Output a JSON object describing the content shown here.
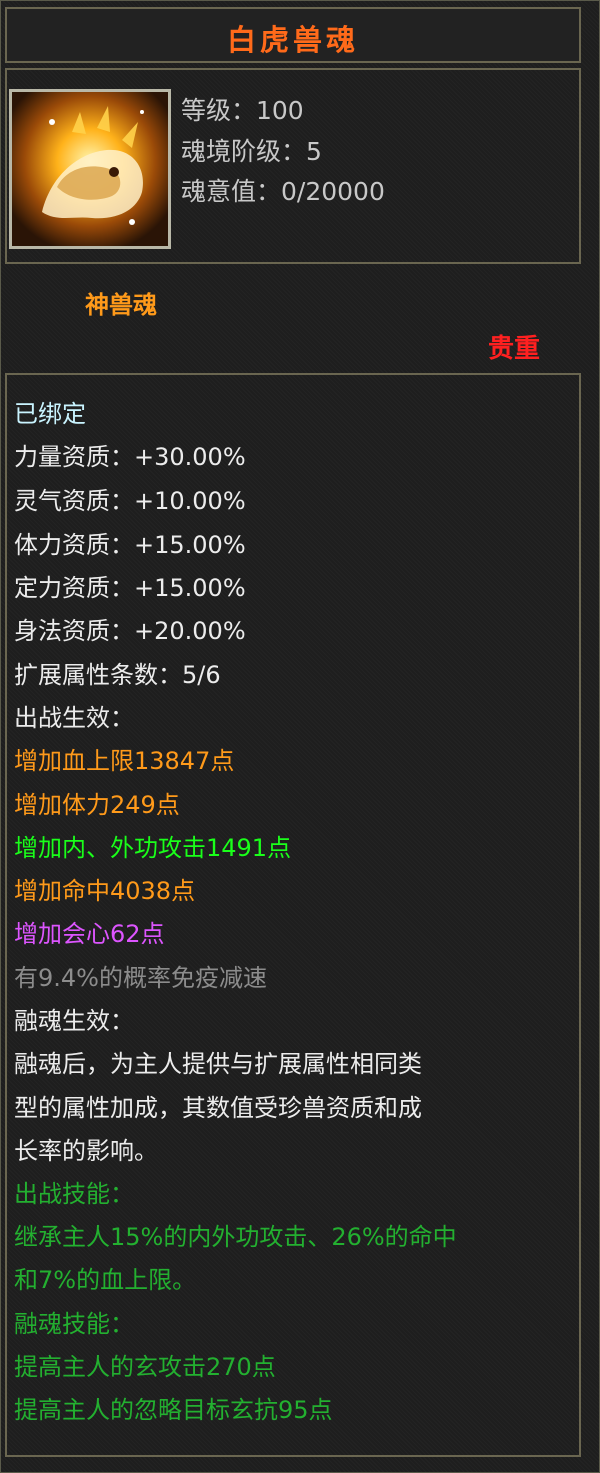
{
  "title": "白虎兽魂",
  "icon_name": "white-tiger-soul-icon",
  "stats": {
    "level": "等级：100",
    "soul_tier": "魂境阶级：5",
    "soul_value": "魂意值：0/20000"
  },
  "category": "神兽魂",
  "rarity": "贵重",
  "lines": {
    "bound": "已绑定",
    "strength": "力量资质：+30.00%",
    "spirit": "灵气资质：+10.00%",
    "stamina": "体力资质：+15.00%",
    "focus": "定力资质：+15.00%",
    "agility": "身法资质：+20.00%",
    "ext_count": "扩展属性条数：5/6",
    "battle_effect": "出战生效：",
    "hp": "增加血上限13847点",
    "vit": "增加体力249点",
    "attack": "增加内、外功攻击1491点",
    "hit": "增加命中4038点",
    "crit": "增加会心62点",
    "slow_immune": "有9.4%的概率免疫减速",
    "fuse_effect": "融魂生效：",
    "fuse_desc_1": "融魂后，为主人提供与扩展属性相同类",
    "fuse_desc_2": "型的属性加成，其数值受珍兽资质和成",
    "fuse_desc_3": "长率的影响。",
    "battle_skill": "出战技能：",
    "battle_skill_1": "继承主人15%的内外功攻击、26%的命中",
    "battle_skill_2": "和7%的血上限。",
    "fuse_skill": "融魂技能：",
    "fuse_skill_1": "提高主人的玄攻击270点",
    "fuse_skill_2": "提高主人的忽略目标玄抗95点"
  },
  "colors": {
    "title": "#ff6a1a",
    "orange": "#ff9a1a",
    "green": "#1aff1a",
    "purple": "#dd55ff",
    "red": "#ff2020"
  }
}
